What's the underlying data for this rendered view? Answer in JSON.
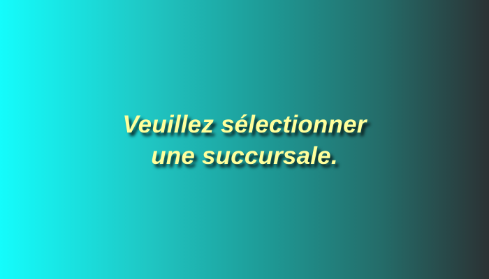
{
  "message": {
    "line1": "Veuillez sélectionner",
    "line2": "une succursale."
  },
  "colors": {
    "background_left": "#14fcfc",
    "background_right": "#2b3234",
    "text": "#ffff9c"
  }
}
